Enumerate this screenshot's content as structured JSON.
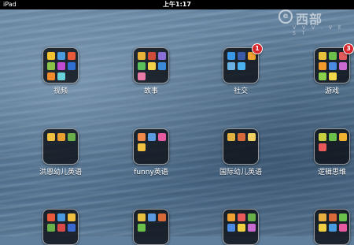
{
  "status_bar": {
    "device": "iPad",
    "time": "上午1:17"
  },
  "watermark": {
    "text": "西部",
    "logo_glyph": "e",
    "sub_text": "V V V . V E S T"
  },
  "folders": [
    {
      "name": "视频",
      "badge": "",
      "icons": [
        "#f2c230",
        "#4a9be0",
        "#e85a3a",
        "#8bc34a",
        "#c24bd1",
        "#2f6fd1",
        "#f08a2a",
        "#6ad0d8"
      ]
    },
    {
      "name": "故事",
      "badge": "",
      "icons": [
        "#e8b23a",
        "#d14b3a",
        "#8a6fd8",
        "#5bbf5a",
        "#f2d04a",
        "#3a8ad8",
        "#e87aa8"
      ]
    },
    {
      "name": "社交",
      "badge": "1",
      "icons": [
        "#3b98e8",
        "#3b5ba8",
        "#f0a030",
        "#6ab0e0",
        "#4ab0f0"
      ]
    },
    {
      "name": "游戏",
      "badge": "3",
      "icons": [
        "#e8c23a",
        "#6ac04a",
        "#e05a5a",
        "#f29a2a",
        "#4a8ae0",
        "#c86ad0",
        "#8ad04a",
        "#f0d84a"
      ]
    },
    {
      "name": "洪恩幼儿英语",
      "badge": "",
      "icons": [
        "#f0c040",
        "#e8a030",
        "#6ab04a"
      ]
    },
    {
      "name": "funny英语",
      "badge": "",
      "icons": [
        "#f08a4a",
        "#5a9ae0",
        "#e85aa0",
        "#f0c040"
      ]
    },
    {
      "name": "国际幼儿英语",
      "badge": "",
      "icons": [
        "#e0b040",
        "#d86a3a",
        "#f0d060"
      ]
    },
    {
      "name": "逻辑思维",
      "badge": "",
      "icons": [
        "#c8d040",
        "#6ac04a",
        "#f0b030",
        "#e85a5a"
      ]
    },
    {
      "name": "",
      "badge": "",
      "icons": [
        "#e85a3a",
        "#4a9ae0",
        "#f0c040",
        "#6ab04a",
        "#d84a4a",
        "#3a6ad0"
      ]
    },
    {
      "name": "",
      "badge": "",
      "icons": [
        "#e8c040",
        "#5a9ae0",
        "#d86a3a",
        "#6ac04a"
      ]
    },
    {
      "name": "",
      "badge": "",
      "icons": [
        "#f0a030",
        "#e85a5a",
        "#6ab04a",
        "#4a8ae0",
        "#f0d040",
        "#c86ad0"
      ]
    },
    {
      "name": "",
      "badge": "",
      "icons": [
        "#e8b040",
        "#d86a3a",
        "#6ac04a",
        "#f0d040",
        "#4a9ae0",
        "#e85aa0"
      ]
    }
  ]
}
